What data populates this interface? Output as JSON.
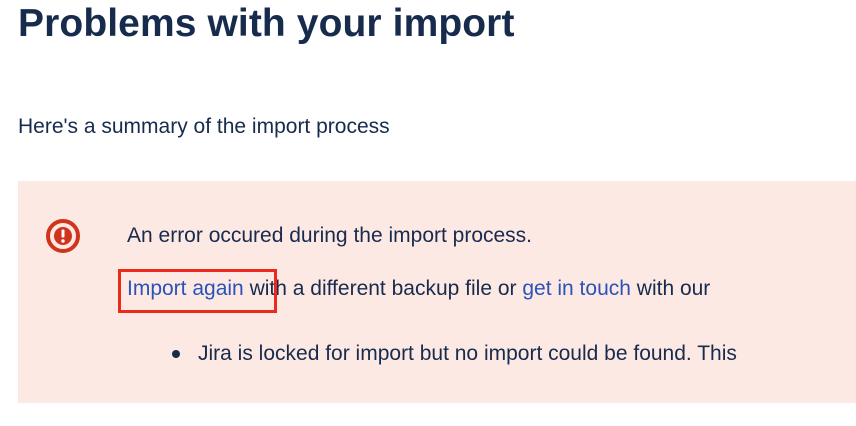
{
  "page": {
    "title": "Problems with your import",
    "summary": "Here's a summary of the import process"
  },
  "error_panel": {
    "icon": "error-circle-icon",
    "colors": {
      "background": "#fde9e4",
      "icon": "#d0341d",
      "link": "#2a53b8",
      "highlight": "#ec2a1c"
    },
    "message": "An error occured during the import process.",
    "import_again_link": "Import again",
    "middle_text": " with a different backup file or ",
    "get_in_touch_link": "get in touch",
    "trailing_text": " with our",
    "details": [
      "Jira is locked for import but no import could be found. This"
    ]
  }
}
